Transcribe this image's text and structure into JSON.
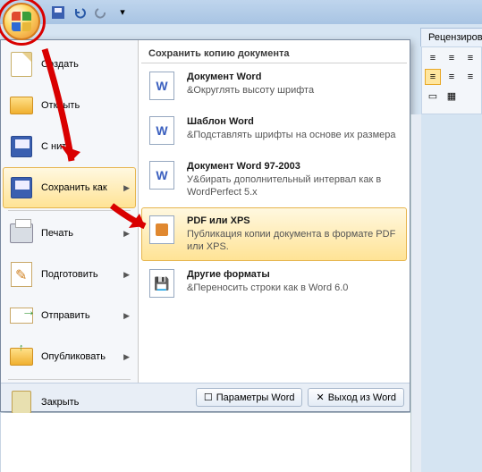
{
  "qat": {
    "save": "save",
    "undo": "undo",
    "redo": "redo"
  },
  "ribbon_tab": "Рецензиров",
  "left_menu": {
    "new": "Создать",
    "open": "Открыть",
    "save": "С         нить",
    "save_as": "Сохранить как",
    "print": "Печать",
    "prepare": "Подготовить",
    "send": "Отправить",
    "publish": "Опубликовать",
    "close": "Закрыть"
  },
  "right_panel": {
    "title": "Сохранить копию документа",
    "items": [
      {
        "t": "Документ Word",
        "d": "&Округлять высоту шрифта"
      },
      {
        "t": "Шаблон Word",
        "d": "&Подставлять шрифты на основе их размера"
      },
      {
        "t": "Документ Word 97-2003",
        "d": "У&бирать дополнительный интервал как в WordPerfect 5.x"
      },
      {
        "t": "PDF или XPS",
        "d": "Публикация копии документа в формате PDF или XPS."
      },
      {
        "t": "Другие форматы",
        "d": "&Переносить строки как в Word 6.0"
      }
    ]
  },
  "bottom": {
    "options": "Параметры Word",
    "exit": "Выход из Word"
  }
}
